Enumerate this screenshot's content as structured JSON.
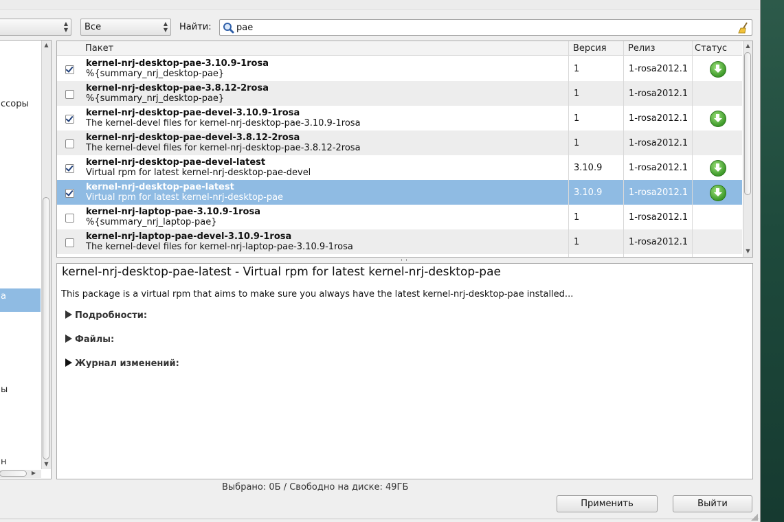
{
  "filters": {
    "group_combo": "",
    "status_combo": "Все",
    "find_label": "Найти:",
    "search_value": "pae"
  },
  "left_panel": {
    "items": [
      "ссоры",
      "а",
      "ы",
      "н"
    ]
  },
  "table": {
    "headers": [
      "Пакет",
      "Версия",
      "Релиз",
      "Статус"
    ],
    "rows": [
      {
        "name": "kernel-nrj-desktop-pae-3.10.9-1rosa",
        "summary": "%{summary_nrj_desktop-pae}",
        "version": "1",
        "release": "1-rosa2012.1",
        "checked": true,
        "status": "download"
      },
      {
        "name": "kernel-nrj-desktop-pae-3.8.12-2rosa",
        "summary": "%{summary_nrj_desktop-pae}",
        "version": "1",
        "release": "1-rosa2012.1",
        "checked": false,
        "status": ""
      },
      {
        "name": "kernel-nrj-desktop-pae-devel-3.10.9-1rosa",
        "summary": "The kernel-devel files for kernel-nrj-desktop-pae-3.10.9-1rosa",
        "version": "1",
        "release": "1-rosa2012.1",
        "checked": true,
        "status": "download"
      },
      {
        "name": "kernel-nrj-desktop-pae-devel-3.8.12-2rosa",
        "summary": "The kernel-devel files for kernel-nrj-desktop-pae-3.8.12-2rosa",
        "version": "1",
        "release": "1-rosa2012.1",
        "checked": false,
        "status": ""
      },
      {
        "name": "kernel-nrj-desktop-pae-devel-latest",
        "summary": "Virtual rpm for latest kernel-nrj-desktop-pae-devel",
        "version": "3.10.9",
        "release": "1-rosa2012.1",
        "checked": true,
        "status": "download"
      },
      {
        "name": "kernel-nrj-desktop-pae-latest",
        "summary": "Virtual rpm for latest kernel-nrj-desktop-pae",
        "version": "3.10.9",
        "release": "1-rosa2012.1",
        "checked": true,
        "status": "download",
        "selected": true
      },
      {
        "name": "kernel-nrj-laptop-pae-3.10.9-1rosa",
        "summary": "%{summary_nrj_laptop-pae}",
        "version": "1",
        "release": "1-rosa2012.1",
        "checked": false,
        "status": ""
      },
      {
        "name": "kernel-nrj-laptop-pae-devel-3.10.9-1rosa",
        "summary": "The kernel-devel files for kernel-nrj-laptop-pae-3.10.9-1rosa",
        "version": "1",
        "release": "1-rosa2012.1",
        "checked": false,
        "status": ""
      }
    ]
  },
  "details": {
    "title": "kernel-nrj-desktop-pae-latest - Virtual rpm for latest kernel-nrj-desktop-pae",
    "description": "This package is a virtual rpm that aims to make sure you always have the latest kernel-nrj-desktop-pae installed...",
    "sections": [
      "Подробности:",
      "Файлы:",
      "Журнал изменений:"
    ]
  },
  "footer": {
    "status": "Выбрано: 0Б / Свободно на диске: 49ГБ",
    "apply_label": "Применить",
    "quit_label": "Выйти"
  },
  "icons": {
    "search": "magnifier-icon",
    "clear": "broom-icon",
    "status": "download-icon"
  },
  "colors": {
    "selection": "#8fbbe3",
    "download_green": "#3e9a2a"
  }
}
